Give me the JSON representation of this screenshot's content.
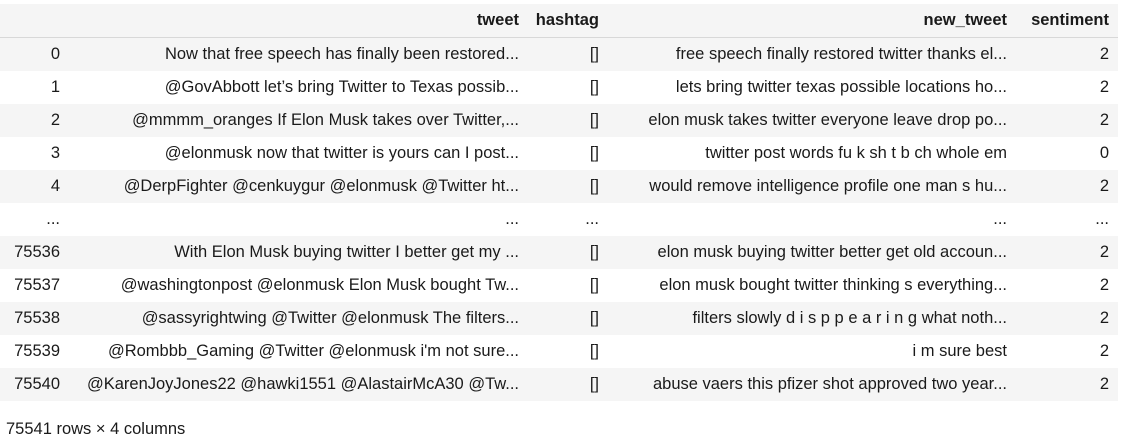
{
  "dataframe": {
    "columns": [
      "tweet",
      "hashtag",
      "new_tweet",
      "sentiment"
    ],
    "rows": [
      {
        "index": "0",
        "tweet": "Now that free speech has finally been restored...",
        "hashtag": "[]",
        "new_tweet": "free speech finally restored twitter thanks el...",
        "sentiment": "2"
      },
      {
        "index": "1",
        "tweet": "@GovAbbott let’s bring Twitter to Texas possib...",
        "hashtag": "[]",
        "new_tweet": "lets bring twitter texas possible locations ho...",
        "sentiment": "2"
      },
      {
        "index": "2",
        "tweet": "@mmmm_oranges If Elon Musk takes over Twitter,...",
        "hashtag": "[]",
        "new_tweet": "elon musk takes twitter everyone leave drop po...",
        "sentiment": "2"
      },
      {
        "index": "3",
        "tweet": "@elonmusk now that twitter is yours can I post...",
        "hashtag": "[]",
        "new_tweet": "twitter post words fu k sh t b ch whole em",
        "sentiment": "0"
      },
      {
        "index": "4",
        "tweet": "@DerpFighter @cenkuygur @elonmusk @Twitter ht...",
        "hashtag": "[]",
        "new_tweet": "would remove intelligence profile one man s hu...",
        "sentiment": "2"
      },
      {
        "index": "...",
        "tweet": "...",
        "hashtag": "...",
        "new_tweet": "...",
        "sentiment": "..."
      },
      {
        "index": "75536",
        "tweet": "With Elon Musk buying twitter I better get my ...",
        "hashtag": "[]",
        "new_tweet": "elon musk buying twitter better get old accoun...",
        "sentiment": "2"
      },
      {
        "index": "75537",
        "tweet": "@washingtonpost @elonmusk Elon Musk bought Tw...",
        "hashtag": "[]",
        "new_tweet": "elon musk bought twitter thinking s everything...",
        "sentiment": "2"
      },
      {
        "index": "75538",
        "tweet": "@sassyrightwing @Twitter @elonmusk The filters...",
        "hashtag": "[]",
        "new_tweet": "filters slowly d i s p p e a r i n g what noth...",
        "sentiment": "2"
      },
      {
        "index": "75539",
        "tweet": "@Rombbb_Gaming @Twitter @elonmusk i'm not sure...",
        "hashtag": "[]",
        "new_tweet": "i m sure best",
        "sentiment": "2"
      },
      {
        "index": "75540",
        "tweet": "@KarenJoyJones22 @hawki1551 @AlastairMcA30 @Tw...",
        "hashtag": "[]",
        "new_tweet": "abuse vaers this pfizer shot approved two year...",
        "sentiment": "2"
      }
    ],
    "shape_text": "75541 rows × 4 columns"
  }
}
